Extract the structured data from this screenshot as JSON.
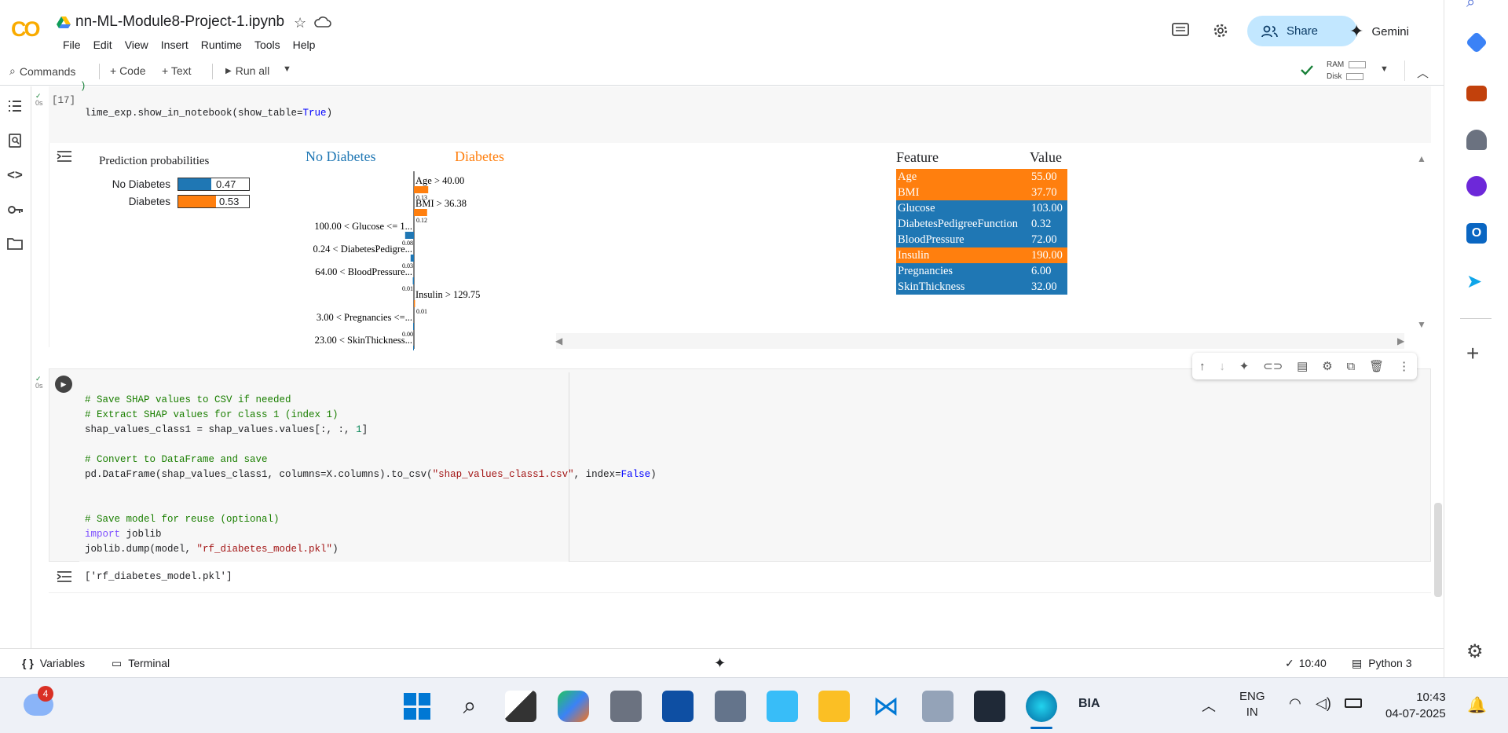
{
  "app": {
    "logo": "CO",
    "notebook_title": "nn-ML-Module8-Project-1.ipynb",
    "menu": [
      "File",
      "Edit",
      "View",
      "Insert",
      "Runtime",
      "Tools",
      "Help"
    ],
    "share_label": "Share",
    "gemini_label": "Gemini"
  },
  "toolbar": {
    "commands": "Commands",
    "add_code": "+ Code",
    "add_text": "+ Text",
    "run_all": "Run all",
    "ram_label": "RAM",
    "disk_label": "Disk"
  },
  "cell17": {
    "exec_count": "[17]",
    "time": "0s",
    "prefix_line": ")",
    "code": {
      "obj": "lime_exp.show_in_notebook(show_table=",
      "bool": "True",
      "close": ")"
    },
    "output": {
      "pred_title": "Prediction probabilities",
      "pred_rows": [
        {
          "label": "No Diabetes",
          "value": "0.47",
          "p": 0.47,
          "color": "#1f77b4"
        },
        {
          "label": "Diabetes",
          "value": "0.53",
          "p": 0.53,
          "color": "#ff7f0e"
        }
      ],
      "class_left": "No Diabetes",
      "class_right": "Diabetes",
      "features": [
        {
          "label": "Age > 40.00",
          "weight": "0.13",
          "w": 0.13,
          "side": "right",
          "color": "#ff7f0e"
        },
        {
          "label": "BMI > 36.38",
          "weight": "0.12",
          "w": 0.12,
          "side": "right",
          "color": "#ff7f0e"
        },
        {
          "label": "100.00 < Glucose <= 1...",
          "weight": "0.08",
          "w": 0.08,
          "side": "left",
          "color": "#1f77b4"
        },
        {
          "label": "0.24 < DiabetesPedigre...",
          "weight": "0.03",
          "w": 0.03,
          "side": "left",
          "color": "#1f77b4"
        },
        {
          "label": "64.00 < BloodPressure...",
          "weight": "0.01",
          "w": 0.01,
          "side": "left",
          "color": "#1f77b4"
        },
        {
          "label": "Insulin > 129.75",
          "weight": "0.01",
          "w": 0.01,
          "side": "right",
          "color": "#ff7f0e"
        },
        {
          "label": "3.00 < Pregnancies <=...",
          "weight": "0.00",
          "w": 0.0,
          "side": "left",
          "color": "#1f77b4"
        },
        {
          "label": "23.00 < SkinThickness...",
          "weight": "0.00",
          "w": 0.0,
          "side": "left",
          "color": "#1f77b4"
        }
      ],
      "table_headers": [
        "Feature",
        "Value"
      ],
      "table_rows": [
        {
          "feature": "Age",
          "value": "55.00",
          "color": "#ff7f0e"
        },
        {
          "feature": "BMI",
          "value": "37.70",
          "color": "#ff7f0e"
        },
        {
          "feature": "Glucose",
          "value": "103.00",
          "color": "#1f77b4"
        },
        {
          "feature": "DiabetesPedigreeFunction",
          "value": "0.32",
          "color": "#1f77b4"
        },
        {
          "feature": "BloodPressure",
          "value": "72.00",
          "color": "#1f77b4"
        },
        {
          "feature": "Insulin",
          "value": "190.00",
          "color": "#ff7f0e"
        },
        {
          "feature": "Pregnancies",
          "value": "6.00",
          "color": "#1f77b4"
        },
        {
          "feature": "SkinThickness",
          "value": "32.00",
          "color": "#1f77b4"
        }
      ]
    }
  },
  "cell18": {
    "time": "0s",
    "lines": {
      "l1": "# Save SHAP values to CSV if needed",
      "l2": "# Extract SHAP values for class 1 (index 1)",
      "l3a": "shap_values_class1 = shap_values.values[:, :, ",
      "l3n": "1",
      "l3c": "]",
      "l5": "# Convert to DataFrame and save",
      "l6a": "pd.DataFrame(shap_values_class1, columns=X.columns).to_csv(",
      "l6s": "\"shap_values_class1.csv\"",
      "l6b": ", index=",
      "l6f": "False",
      "l6c": ")",
      "l9": "# Save model for reuse (optional)",
      "l10k": "import",
      "l10b": " joblib",
      "l11a": "joblib.dump(model, ",
      "l11s": "\"rf_diabetes_model.pkl\"",
      "l11c": ")"
    },
    "output": "['rf_diabetes_model.pkl']"
  },
  "statusbar": {
    "variables": "Variables",
    "terminal": "Terminal",
    "time": "10:40",
    "runtime": "Python 3"
  },
  "taskbar": {
    "badge": "4",
    "lang1": "ENG",
    "lang2": "IN",
    "clock": "10:43",
    "date": "04-07-2025",
    "bia": "BIA"
  },
  "colors": {
    "orange": "#ff7f0e",
    "blue": "#1f77b4",
    "share_bg": "#c2e7ff"
  }
}
